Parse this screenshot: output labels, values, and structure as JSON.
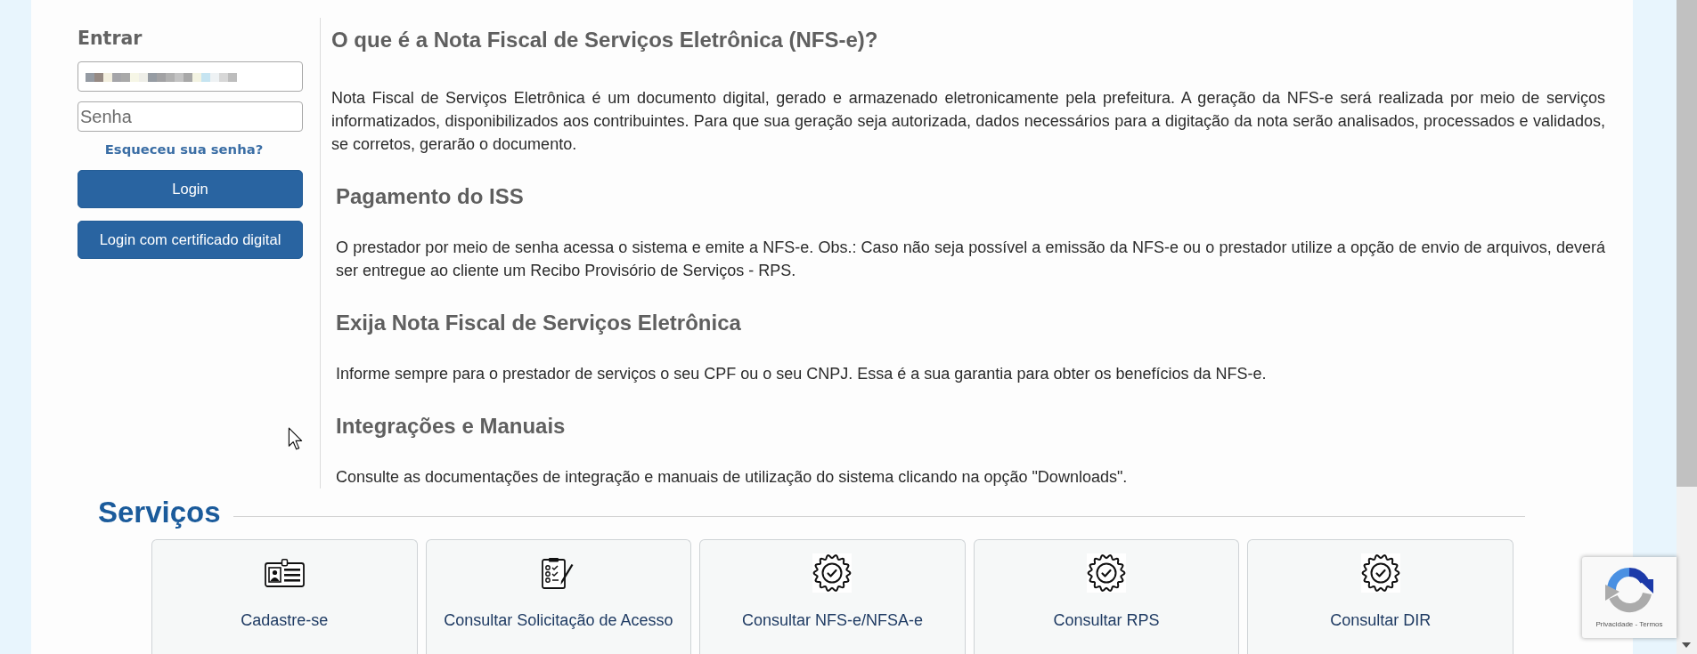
{
  "login": {
    "title": "Entrar",
    "username": {
      "obscured": true
    },
    "password": {
      "placeholder": "Senha"
    },
    "forgot_link": "Esqueceu sua senha?",
    "buttons": [
      "Login",
      "Login com certificado digital"
    ]
  },
  "article": {
    "title": "O que é a Nota Fiscal de Serviços Eletrônica (NFS-e)?",
    "intro": "Nota Fiscal de Serviços Eletrônica é um documento digital, gerado e armazenado eletronicamente pela prefeitura. A geração da NFS-e será realizada por meio de serviços informatizados, disponibilizados aos contribuintes. Para que sua geração seja autorizada, dados necessários para a digitação da nota serão analisados, processados e validados, se corretos, gerarão o documento.",
    "sections": [
      {
        "heading": "Pagamento do ISS",
        "text": "O prestador por meio de senha acessa o sistema e emite a NFS-e. Obs.: Caso não seja possível a emissão da NFS-e ou o prestador utilize a opção de envio de arquivos, deverá ser entregue ao cliente um Recibo Provisório de Serviços - RPS."
      },
      {
        "heading": "Exija Nota Fiscal de Serviços Eletrônica",
        "text": "Informe sempre para o prestador de serviços o seu CPF ou o seu CNPJ. Essa é a sua garantia para obter os benefícios da NFS-e."
      },
      {
        "heading": "Integrações e Manuais",
        "text": "Consulte as documentações de integração e manuais de utilização do sistema clicando na opção \"Downloads\"."
      }
    ]
  },
  "services": {
    "title": "Serviços",
    "items": [
      {
        "kind": "card",
        "label": "Cadastre-se"
      },
      {
        "kind": "clipboard",
        "label": "Consultar Solicitação de Acesso"
      },
      {
        "kind": "seal",
        "label": "Consultar NFS-e/NFSA-e"
      },
      {
        "kind": "seal",
        "label": "Consultar RPS"
      },
      {
        "kind": "seal",
        "label": "Consultar DIR"
      }
    ]
  },
  "captcha": {
    "links": "Privacidade - Termos"
  }
}
